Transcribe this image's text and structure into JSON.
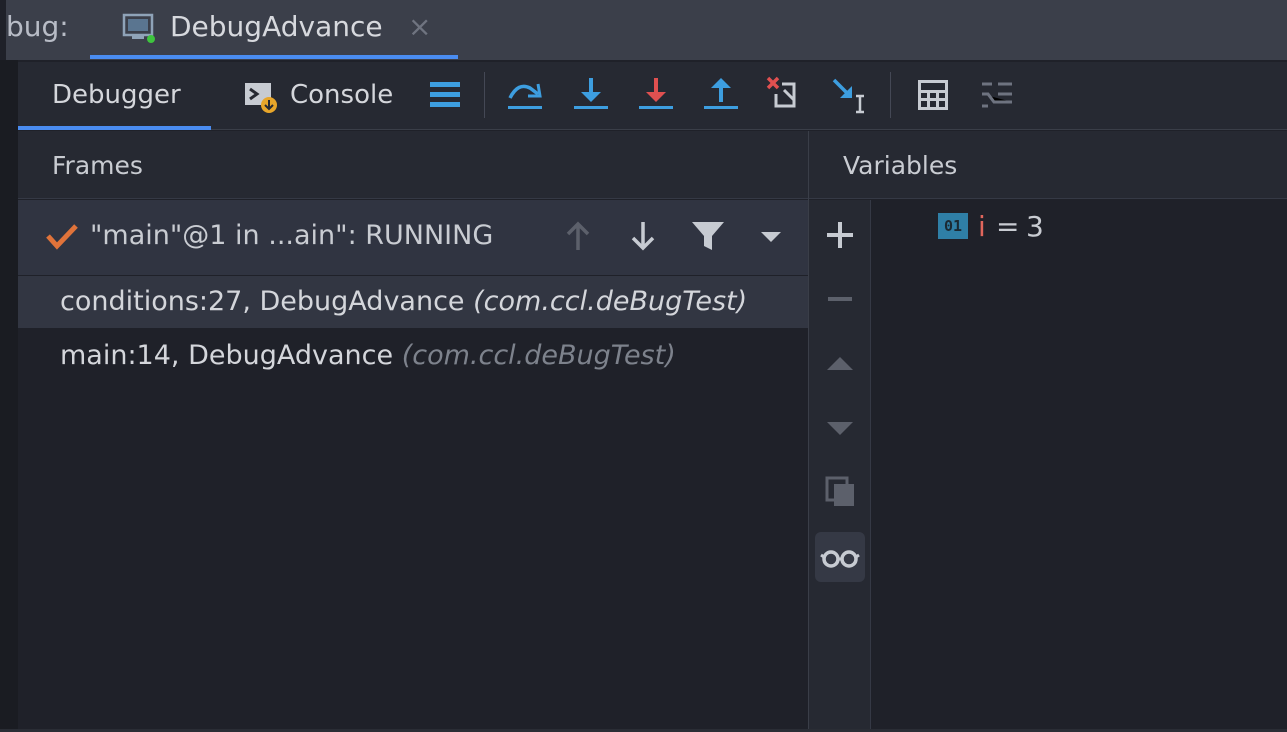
{
  "session": {
    "prefix": "bug:",
    "tab_label": "DebugAdvance",
    "close_glyph": "×"
  },
  "toolbar": {
    "debugger_tab": "Debugger",
    "console_tab": "Console",
    "buttons": [
      "show-execution-point-icon",
      "step-over-icon",
      "step-into-icon",
      "force-step-into-icon",
      "step-out-icon",
      "drop-frame-icon",
      "run-to-cursor-icon",
      "evaluate-expression-icon",
      "trace-current-stream-icon"
    ]
  },
  "frames": {
    "title": "Frames",
    "thread_label": "\"main\"@1 in ...ain\": RUNNING",
    "items": [
      {
        "method": "conditions:27, DebugAdvance",
        "package": "(com.ccl.deBugTest)"
      },
      {
        "method": "main:14, DebugAdvance",
        "package": "(com.ccl.deBugTest)"
      }
    ]
  },
  "variables": {
    "title": "Variables",
    "items": [
      {
        "type_badge": "01",
        "name": "i",
        "eq": "=",
        "value": "3"
      }
    ]
  },
  "colors": {
    "accent": "#4a8cf0",
    "check": "#e0733a",
    "step_blue": "#3d9ee0",
    "step_red": "#e05050",
    "var_name": "#e0665c"
  }
}
